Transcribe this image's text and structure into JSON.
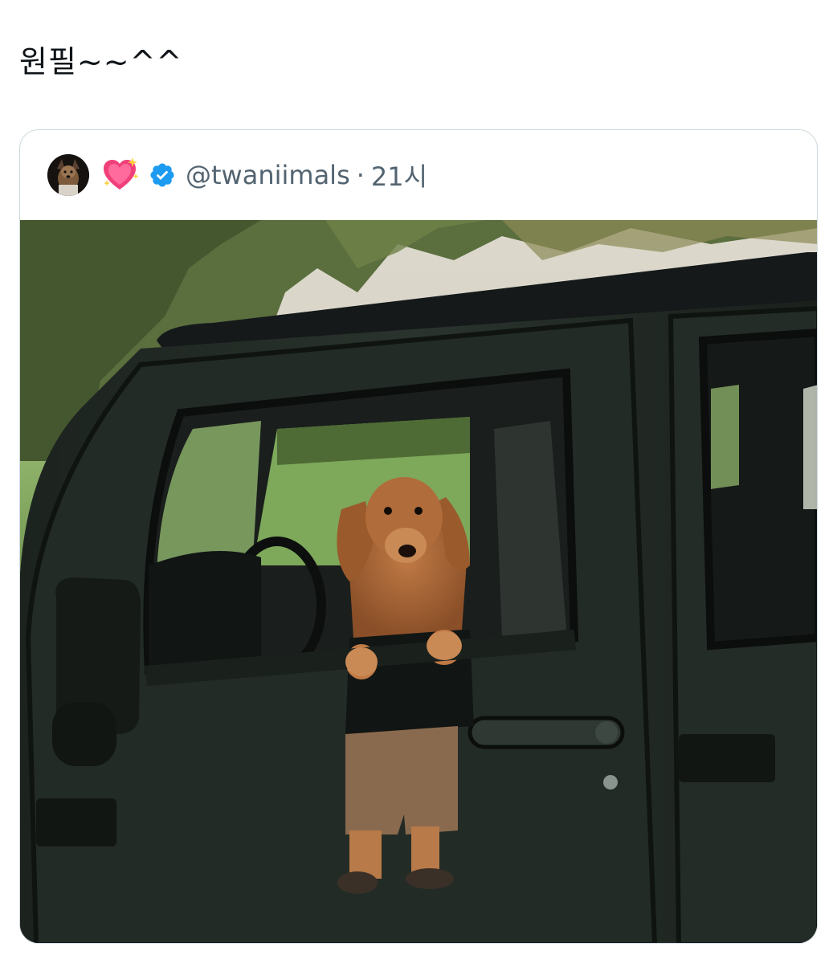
{
  "post": {
    "text": "원필~~^^"
  },
  "quoted_post": {
    "emoji": "💖",
    "handle": "@twaniimals",
    "separator": "·",
    "time": "21시",
    "verified": true,
    "media_description": "Dachshund dog photoshopped standing in shorts and shirt leaning out of a black jeep window",
    "colors": {
      "verified_badge": "#1d9bf0",
      "secondary_text": "#536471",
      "card_border": "#cfd9de"
    }
  }
}
